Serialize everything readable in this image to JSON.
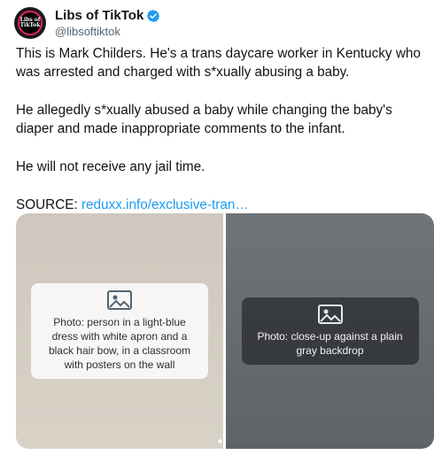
{
  "account": {
    "display_name": "Libs of TikTok",
    "handle": "@libsoftiktok",
    "avatar_text": "Libs of TikTok",
    "verified_color": "#1d9bf0"
  },
  "tweet": {
    "paragraphs": [
      "This is Mark Childers. He's a trans daycare worker in Kentucky who was arrested and charged with s*xually abusing a baby.",
      "He allegedly s*xually abused a baby while changing the baby's diaper and made inappropriate comments to the infant.",
      "He will not receive any jail time."
    ],
    "source_prefix": "SOURCE: ",
    "source_link": "reduxx.info/exclusive-tran…"
  },
  "media": {
    "left_placeholder": "Photo: person in a light-blue dress with white apron and a black hair bow, in a classroom with posters on the wall",
    "right_placeholder": "Photo: close-up against a plain gray backdrop",
    "left_icon": "image-icon",
    "right_icon": "image-icon",
    "dot_count": 2
  }
}
